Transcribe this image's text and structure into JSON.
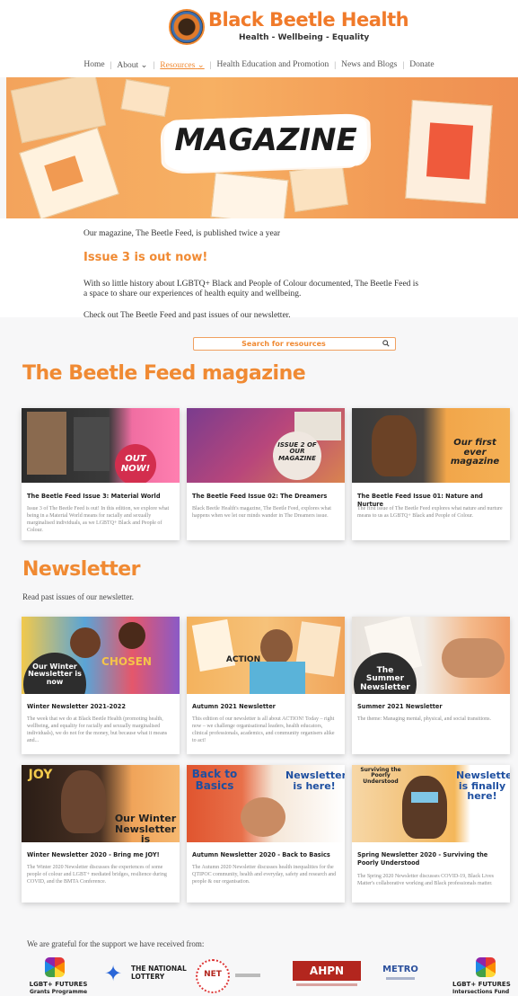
{
  "header": {
    "brand": "Black Beetle Health",
    "tagline": "Health - Wellbeing - Equality"
  },
  "nav": {
    "items": [
      "Home",
      "About",
      "Resources",
      "Health Education and Promotion",
      "News and Blogs",
      "Donate"
    ]
  },
  "hero": {
    "title": "MAGAZINE"
  },
  "intro": {
    "line1": "Our magazine, The Beetle Feed, is published twice a year",
    "issue_heading": "Issue 3 is out now!",
    "body_line1": "With so little history about LGBTQ+ Black and People of Colour documented, The Beetle Feed is",
    "body_line2": "a space to share our experiences of health equity and wellbeing.",
    "check_out": "Check out The Beetle Feed and past issues of our newsletter."
  },
  "search": {
    "placeholder": "Search for resources"
  },
  "magazine": {
    "heading": "The Beetle Feed magazine",
    "cards": [
      {
        "title": "The Beetle Feed Issue 3: Material World",
        "desc": "Issue 3 of The Beetle Feed is out! In this edition, we explore what being in a Material World means for racially and sexually marginalised individuals, as we LGBTQ+ Black and People of Colour.",
        "overlay": "OUT NOW!"
      },
      {
        "title": "The Beetle Feed Issue 02: The Dreamers",
        "desc": "Black Beetle Health's magazine, The Beetle Feed, explores what happens when we let our minds wander in The Dreamers issue.",
        "overlay": "ISSUE 2 OF OUR MAGAZINE"
      },
      {
        "title": "The Beetle Feed Issue 01: Nature and Nurture",
        "desc": "The first issue of The Beetle Feed explores what nature and nurture means to us as LGBTQ+ Black and People of Colour.",
        "overlay": "Our first ever magazine"
      }
    ]
  },
  "newsletter": {
    "heading": "Newsletter",
    "sub": "Read past issues of our newsletter.",
    "cards": [
      {
        "title": "Winter Newsletter 2021-2022",
        "desc": "The week that we do at Black Beetle Health (promoting health, wellbeing, and equality for racially and sexually marginalised individuals), we do not for the money, but because what it means and...",
        "overlay": "Our Winter Newsletter is now",
        "image_word": "CHOSEN"
      },
      {
        "title": "Autumn 2021 Newsletter",
        "desc": "This edition of our newsletter is all about ACTION! Today – right now – we challenge organisational leaders, health educators, clinical professionals, academics, and community organisers alike to act!",
        "image_word": "ACTION"
      },
      {
        "title": "Summer 2021 Newsletter",
        "desc": "The theme: Managing mental, physical, and social transitions.",
        "overlay": "The Summer Newsletter"
      },
      {
        "title": "Winter Newsletter 2020 - Bring me JOY!",
        "desc": "The Winter 2020 Newsletter discusses the experiences of some people of colour and LGBT+ mediated bridges, resilience during COVID, and the BMTA Conference.",
        "overlay": "Our Winter Newsletter is",
        "image_word": "JOY"
      },
      {
        "title": "Autumn Newsletter 2020 - Back to Basics",
        "desc": "The Autumn 2020 Newsletter discusses health inequalities for the QTIPOC community, health and everyday, safety and research and people & our organisation.",
        "overlay": "Newsletter is here!",
        "image_word": "Back to Basics"
      },
      {
        "title": "Spring Newsletter 2020 - Surviving the Poorly Understood",
        "desc": "The Spring 2020 Newsletter discusses COVID-19, Black Lives Matter's collaborative working and Black professionals matter.",
        "overlay": "Newsletter is finally here!",
        "image_word": "Surviving the Poorly Understood"
      }
    ]
  },
  "footer": {
    "note": "We are grateful for the support we have received from:",
    "sponsors": [
      {
        "name": "LGBT+ FUTURES",
        "sub": "Grants Programme"
      },
      {
        "name": "THE NATIONAL LOTTERY"
      },
      {
        "name": "NET"
      },
      {
        "name": "AHPN"
      },
      {
        "name": "METRO"
      },
      {
        "name": "LGBT+ FUTURES",
        "sub": "Intersections Fund"
      }
    ]
  },
  "colors": {
    "accent": "#f08a33",
    "brand_orange": "#f07a2a",
    "text": "#333333"
  }
}
